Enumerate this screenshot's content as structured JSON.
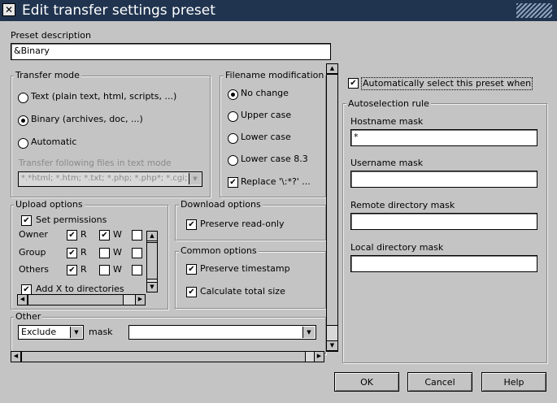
{
  "window": {
    "title": "Edit transfer settings preset"
  },
  "preset": {
    "label": "Preset description",
    "value": "&Binary"
  },
  "transfer_mode": {
    "label": "Transfer mode",
    "options": [
      "Text (plain text, html, scripts, ...)",
      "Binary (archives, doc, ...)",
      "Automatic"
    ],
    "selected": 1,
    "text_mode_label": "Transfer following files in text mode",
    "text_mode_value": "*.*html; *.htm; *.txt; *.php; *.php*; *.cgi; *.c; *.cpp; *.h"
  },
  "filename_mod": {
    "label": "Filename modification",
    "options": [
      "No change",
      "Upper case",
      "Lower case",
      "Lower case 8.3"
    ],
    "selected": 0,
    "replace_label": "Replace '\\:*?' ..."
  },
  "upload": {
    "label": "Upload options",
    "set_permissions": "Set permissions",
    "rows": [
      {
        "name": "Owner",
        "r": true,
        "w": true,
        "x": false
      },
      {
        "name": "Group",
        "r": true,
        "w": false,
        "x": false
      },
      {
        "name": "Others",
        "r": true,
        "w": false,
        "x": false
      }
    ],
    "r_label": "R",
    "w_label": "W",
    "add_x": "Add X to directories"
  },
  "download": {
    "label": "Download options",
    "preserve_readonly": "Preserve read-only"
  },
  "common": {
    "label": "Common options",
    "preserve_timestamp": "Preserve timestamp",
    "calc_total": "Calculate total size"
  },
  "other": {
    "label": "Other",
    "exclude_value": "Exclude",
    "mask_label": "mask",
    "mask_value": ""
  },
  "autoselect": {
    "checkbox_label": "Automatically select this preset when",
    "rule_label": "Autoselection rule",
    "hostname_label": "Hostname mask",
    "hostname_value": "*",
    "username_label": "Username mask",
    "username_value": "",
    "remote_label": "Remote directory mask",
    "remote_value": "",
    "local_label": "Local directory mask",
    "local_value": ""
  },
  "buttons": {
    "ok": "OK",
    "cancel": "Cancel",
    "help": "Help"
  },
  "check_mark": "✔"
}
